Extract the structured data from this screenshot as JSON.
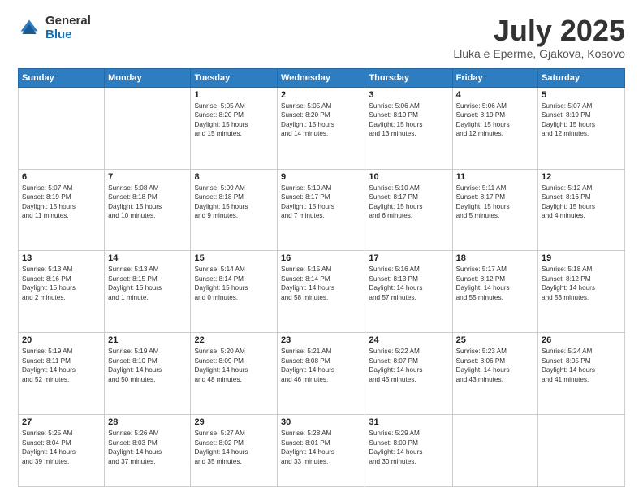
{
  "header": {
    "logo_general": "General",
    "logo_blue": "Blue",
    "month": "July 2025",
    "location": "Lluka e Eperme, Gjakova, Kosovo"
  },
  "days_of_week": [
    "Sunday",
    "Monday",
    "Tuesday",
    "Wednesday",
    "Thursday",
    "Friday",
    "Saturday"
  ],
  "weeks": [
    [
      {
        "day": "",
        "info": ""
      },
      {
        "day": "",
        "info": ""
      },
      {
        "day": "1",
        "info": "Sunrise: 5:05 AM\nSunset: 8:20 PM\nDaylight: 15 hours\nand 15 minutes."
      },
      {
        "day": "2",
        "info": "Sunrise: 5:05 AM\nSunset: 8:20 PM\nDaylight: 15 hours\nand 14 minutes."
      },
      {
        "day": "3",
        "info": "Sunrise: 5:06 AM\nSunset: 8:19 PM\nDaylight: 15 hours\nand 13 minutes."
      },
      {
        "day": "4",
        "info": "Sunrise: 5:06 AM\nSunset: 8:19 PM\nDaylight: 15 hours\nand 12 minutes."
      },
      {
        "day": "5",
        "info": "Sunrise: 5:07 AM\nSunset: 8:19 PM\nDaylight: 15 hours\nand 12 minutes."
      }
    ],
    [
      {
        "day": "6",
        "info": "Sunrise: 5:07 AM\nSunset: 8:19 PM\nDaylight: 15 hours\nand 11 minutes."
      },
      {
        "day": "7",
        "info": "Sunrise: 5:08 AM\nSunset: 8:18 PM\nDaylight: 15 hours\nand 10 minutes."
      },
      {
        "day": "8",
        "info": "Sunrise: 5:09 AM\nSunset: 8:18 PM\nDaylight: 15 hours\nand 9 minutes."
      },
      {
        "day": "9",
        "info": "Sunrise: 5:10 AM\nSunset: 8:17 PM\nDaylight: 15 hours\nand 7 minutes."
      },
      {
        "day": "10",
        "info": "Sunrise: 5:10 AM\nSunset: 8:17 PM\nDaylight: 15 hours\nand 6 minutes."
      },
      {
        "day": "11",
        "info": "Sunrise: 5:11 AM\nSunset: 8:17 PM\nDaylight: 15 hours\nand 5 minutes."
      },
      {
        "day": "12",
        "info": "Sunrise: 5:12 AM\nSunset: 8:16 PM\nDaylight: 15 hours\nand 4 minutes."
      }
    ],
    [
      {
        "day": "13",
        "info": "Sunrise: 5:13 AM\nSunset: 8:16 PM\nDaylight: 15 hours\nand 2 minutes."
      },
      {
        "day": "14",
        "info": "Sunrise: 5:13 AM\nSunset: 8:15 PM\nDaylight: 15 hours\nand 1 minute."
      },
      {
        "day": "15",
        "info": "Sunrise: 5:14 AM\nSunset: 8:14 PM\nDaylight: 15 hours\nand 0 minutes."
      },
      {
        "day": "16",
        "info": "Sunrise: 5:15 AM\nSunset: 8:14 PM\nDaylight: 14 hours\nand 58 minutes."
      },
      {
        "day": "17",
        "info": "Sunrise: 5:16 AM\nSunset: 8:13 PM\nDaylight: 14 hours\nand 57 minutes."
      },
      {
        "day": "18",
        "info": "Sunrise: 5:17 AM\nSunset: 8:12 PM\nDaylight: 14 hours\nand 55 minutes."
      },
      {
        "day": "19",
        "info": "Sunrise: 5:18 AM\nSunset: 8:12 PM\nDaylight: 14 hours\nand 53 minutes."
      }
    ],
    [
      {
        "day": "20",
        "info": "Sunrise: 5:19 AM\nSunset: 8:11 PM\nDaylight: 14 hours\nand 52 minutes."
      },
      {
        "day": "21",
        "info": "Sunrise: 5:19 AM\nSunset: 8:10 PM\nDaylight: 14 hours\nand 50 minutes."
      },
      {
        "day": "22",
        "info": "Sunrise: 5:20 AM\nSunset: 8:09 PM\nDaylight: 14 hours\nand 48 minutes."
      },
      {
        "day": "23",
        "info": "Sunrise: 5:21 AM\nSunset: 8:08 PM\nDaylight: 14 hours\nand 46 minutes."
      },
      {
        "day": "24",
        "info": "Sunrise: 5:22 AM\nSunset: 8:07 PM\nDaylight: 14 hours\nand 45 minutes."
      },
      {
        "day": "25",
        "info": "Sunrise: 5:23 AM\nSunset: 8:06 PM\nDaylight: 14 hours\nand 43 minutes."
      },
      {
        "day": "26",
        "info": "Sunrise: 5:24 AM\nSunset: 8:05 PM\nDaylight: 14 hours\nand 41 minutes."
      }
    ],
    [
      {
        "day": "27",
        "info": "Sunrise: 5:25 AM\nSunset: 8:04 PM\nDaylight: 14 hours\nand 39 minutes."
      },
      {
        "day": "28",
        "info": "Sunrise: 5:26 AM\nSunset: 8:03 PM\nDaylight: 14 hours\nand 37 minutes."
      },
      {
        "day": "29",
        "info": "Sunrise: 5:27 AM\nSunset: 8:02 PM\nDaylight: 14 hours\nand 35 minutes."
      },
      {
        "day": "30",
        "info": "Sunrise: 5:28 AM\nSunset: 8:01 PM\nDaylight: 14 hours\nand 33 minutes."
      },
      {
        "day": "31",
        "info": "Sunrise: 5:29 AM\nSunset: 8:00 PM\nDaylight: 14 hours\nand 30 minutes."
      },
      {
        "day": "",
        "info": ""
      },
      {
        "day": "",
        "info": ""
      }
    ]
  ]
}
